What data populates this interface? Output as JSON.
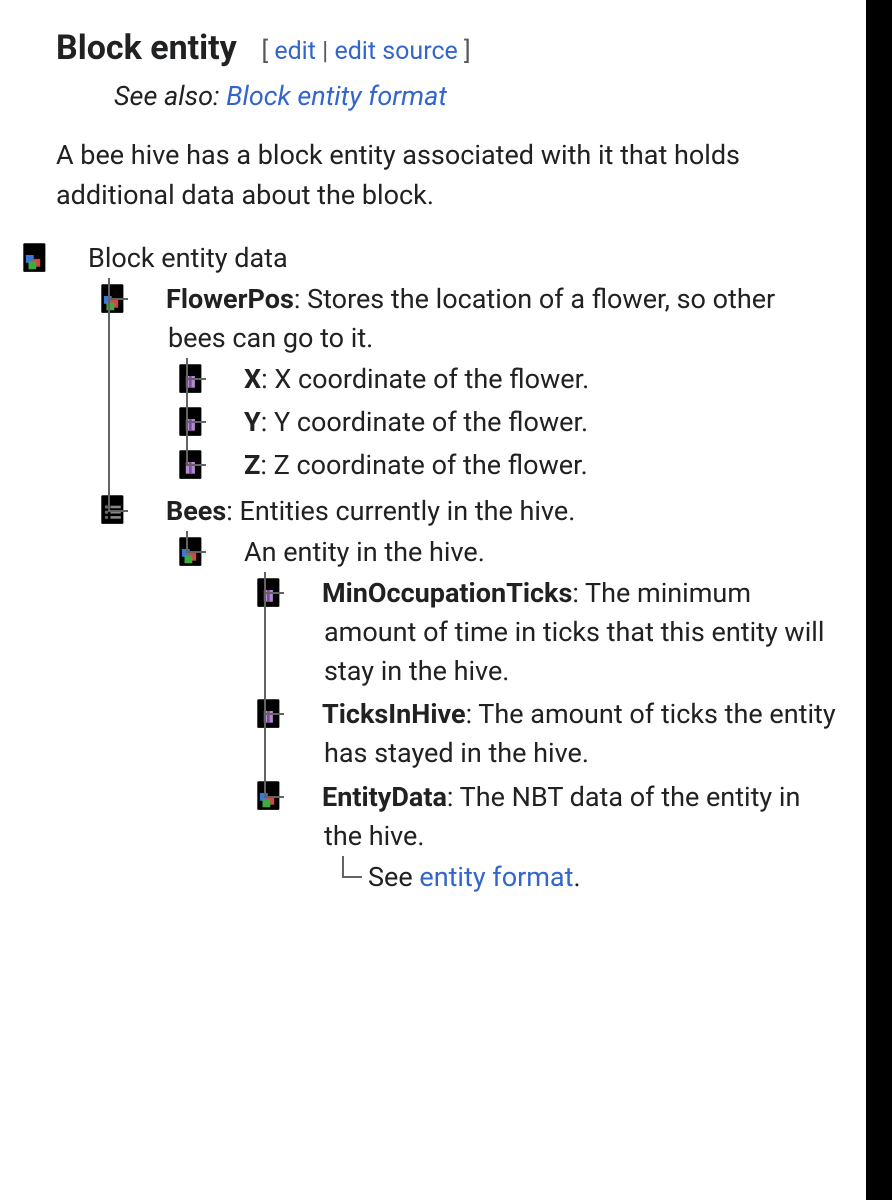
{
  "header": {
    "title": "Block entity",
    "edit_open": "[ ",
    "edit": "edit",
    "sep": " | ",
    "edit_source": "edit source",
    "edit_close": " ]"
  },
  "see_also": {
    "prefix": "See also: ",
    "link": "Block entity format"
  },
  "intro": "A bee hive has a block entity associated with it that holds additional data about the block.",
  "tree": {
    "root": "Block entity data",
    "flowerpos": {
      "name": "FlowerPos",
      "desc": ": Stores the location of a flower, so other bees can go to it.",
      "x": {
        "name": "X",
        "desc": ": X coordinate of the flower."
      },
      "y": {
        "name": "Y",
        "desc": ": Y coordinate of the flower."
      },
      "z": {
        "name": "Z",
        "desc": ": Z coordinate of the flower."
      }
    },
    "bees": {
      "name": "Bees",
      "desc": ": Entities currently in the hive.",
      "entity": {
        "label": "An entity in the hive.",
        "min": {
          "name": "MinOccupationTicks",
          "desc": ": The minimum amount of time in ticks that this entity will stay in the hive."
        },
        "ticks": {
          "name": "TicksInHive",
          "desc": ": The amount of ticks the entity has stayed in the hive."
        },
        "data": {
          "name": "EntityData",
          "desc": ": The NBT data of the entity in the hive.",
          "see_prefix": "See ",
          "see_link": "entity format",
          "see_suffix": "."
        }
      }
    }
  }
}
